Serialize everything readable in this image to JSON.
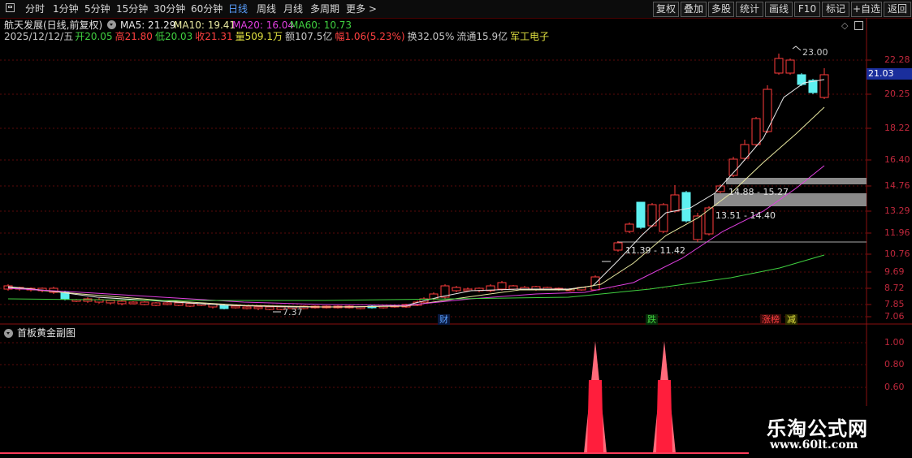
{
  "toolbar": {
    "periods": [
      "分时",
      "1分钟",
      "5分钟",
      "15分钟",
      "30分钟",
      "60分钟",
      "日线",
      "周线",
      "月线",
      "多周期",
      "更多 >"
    ],
    "active_period": "日线",
    "right_buttons": [
      "复权",
      "叠加",
      "多股",
      "统计",
      "画线",
      "F10",
      "标记",
      "+自选",
      "返回"
    ]
  },
  "main_panel": {
    "title": "航天发展(日线,前复权)",
    "ma": [
      {
        "label": "MA5: 21.29",
        "color": "#e8e8e8"
      },
      {
        "label": "MA10: 19.41",
        "color": "#e8e8a0"
      },
      {
        "label": "MA20: 16.04",
        "color": "#e040e0"
      },
      {
        "label": "MA60: 10.73",
        "color": "#40d040"
      }
    ],
    "quote": [
      {
        "text": "2025/12/12/五",
        "color": "#c8c8c8"
      },
      {
        "text": "开20.05",
        "color": "#40d040"
      },
      {
        "text": "高21.80",
        "color": "#ff4040"
      },
      {
        "text": "低20.03",
        "color": "#40d040"
      },
      {
        "text": "收21.31",
        "color": "#ff4040"
      },
      {
        "text": "量509.1万",
        "color": "#e0e040"
      },
      {
        "text": "额107.5亿",
        "color": "#c8c8c8"
      },
      {
        "text": "幅1.06(5.23%)",
        "color": "#ff4040"
      },
      {
        "text": "换32.05%",
        "color": "#c8c8c8"
      },
      {
        "text": "流通15.9亿",
        "color": "#c8c8c8"
      },
      {
        "text": "军工电子",
        "color": "#e0e040"
      }
    ],
    "price_axis": [
      "22.28",
      "20.25",
      "18.22",
      "16.40",
      "14.76",
      "13.29",
      "11.96",
      "10.76",
      "9.69",
      "8.72",
      "7.85",
      "7.06"
    ],
    "current_price": "21.03",
    "high_label": "23.00",
    "low_label": "7.37",
    "zones": [
      "14.88 - 15.27",
      "13.51 - 14.40",
      "11.39 - 11.42"
    ],
    "markers": [
      {
        "text": "财",
        "color": "#5aa0ff"
      },
      {
        "text": "跌",
        "color": "#40d040"
      },
      {
        "text": "涨榜",
        "color": "#ff4040"
      },
      {
        "text": "减",
        "color": "#e0e040"
      }
    ]
  },
  "sub_panel": {
    "title": "首板黄金副图",
    "axis": [
      "1.00",
      "0.80",
      "0.60"
    ]
  },
  "watermark": {
    "name": "乐淘公式网",
    "url": "www.60lt.com"
  }
}
